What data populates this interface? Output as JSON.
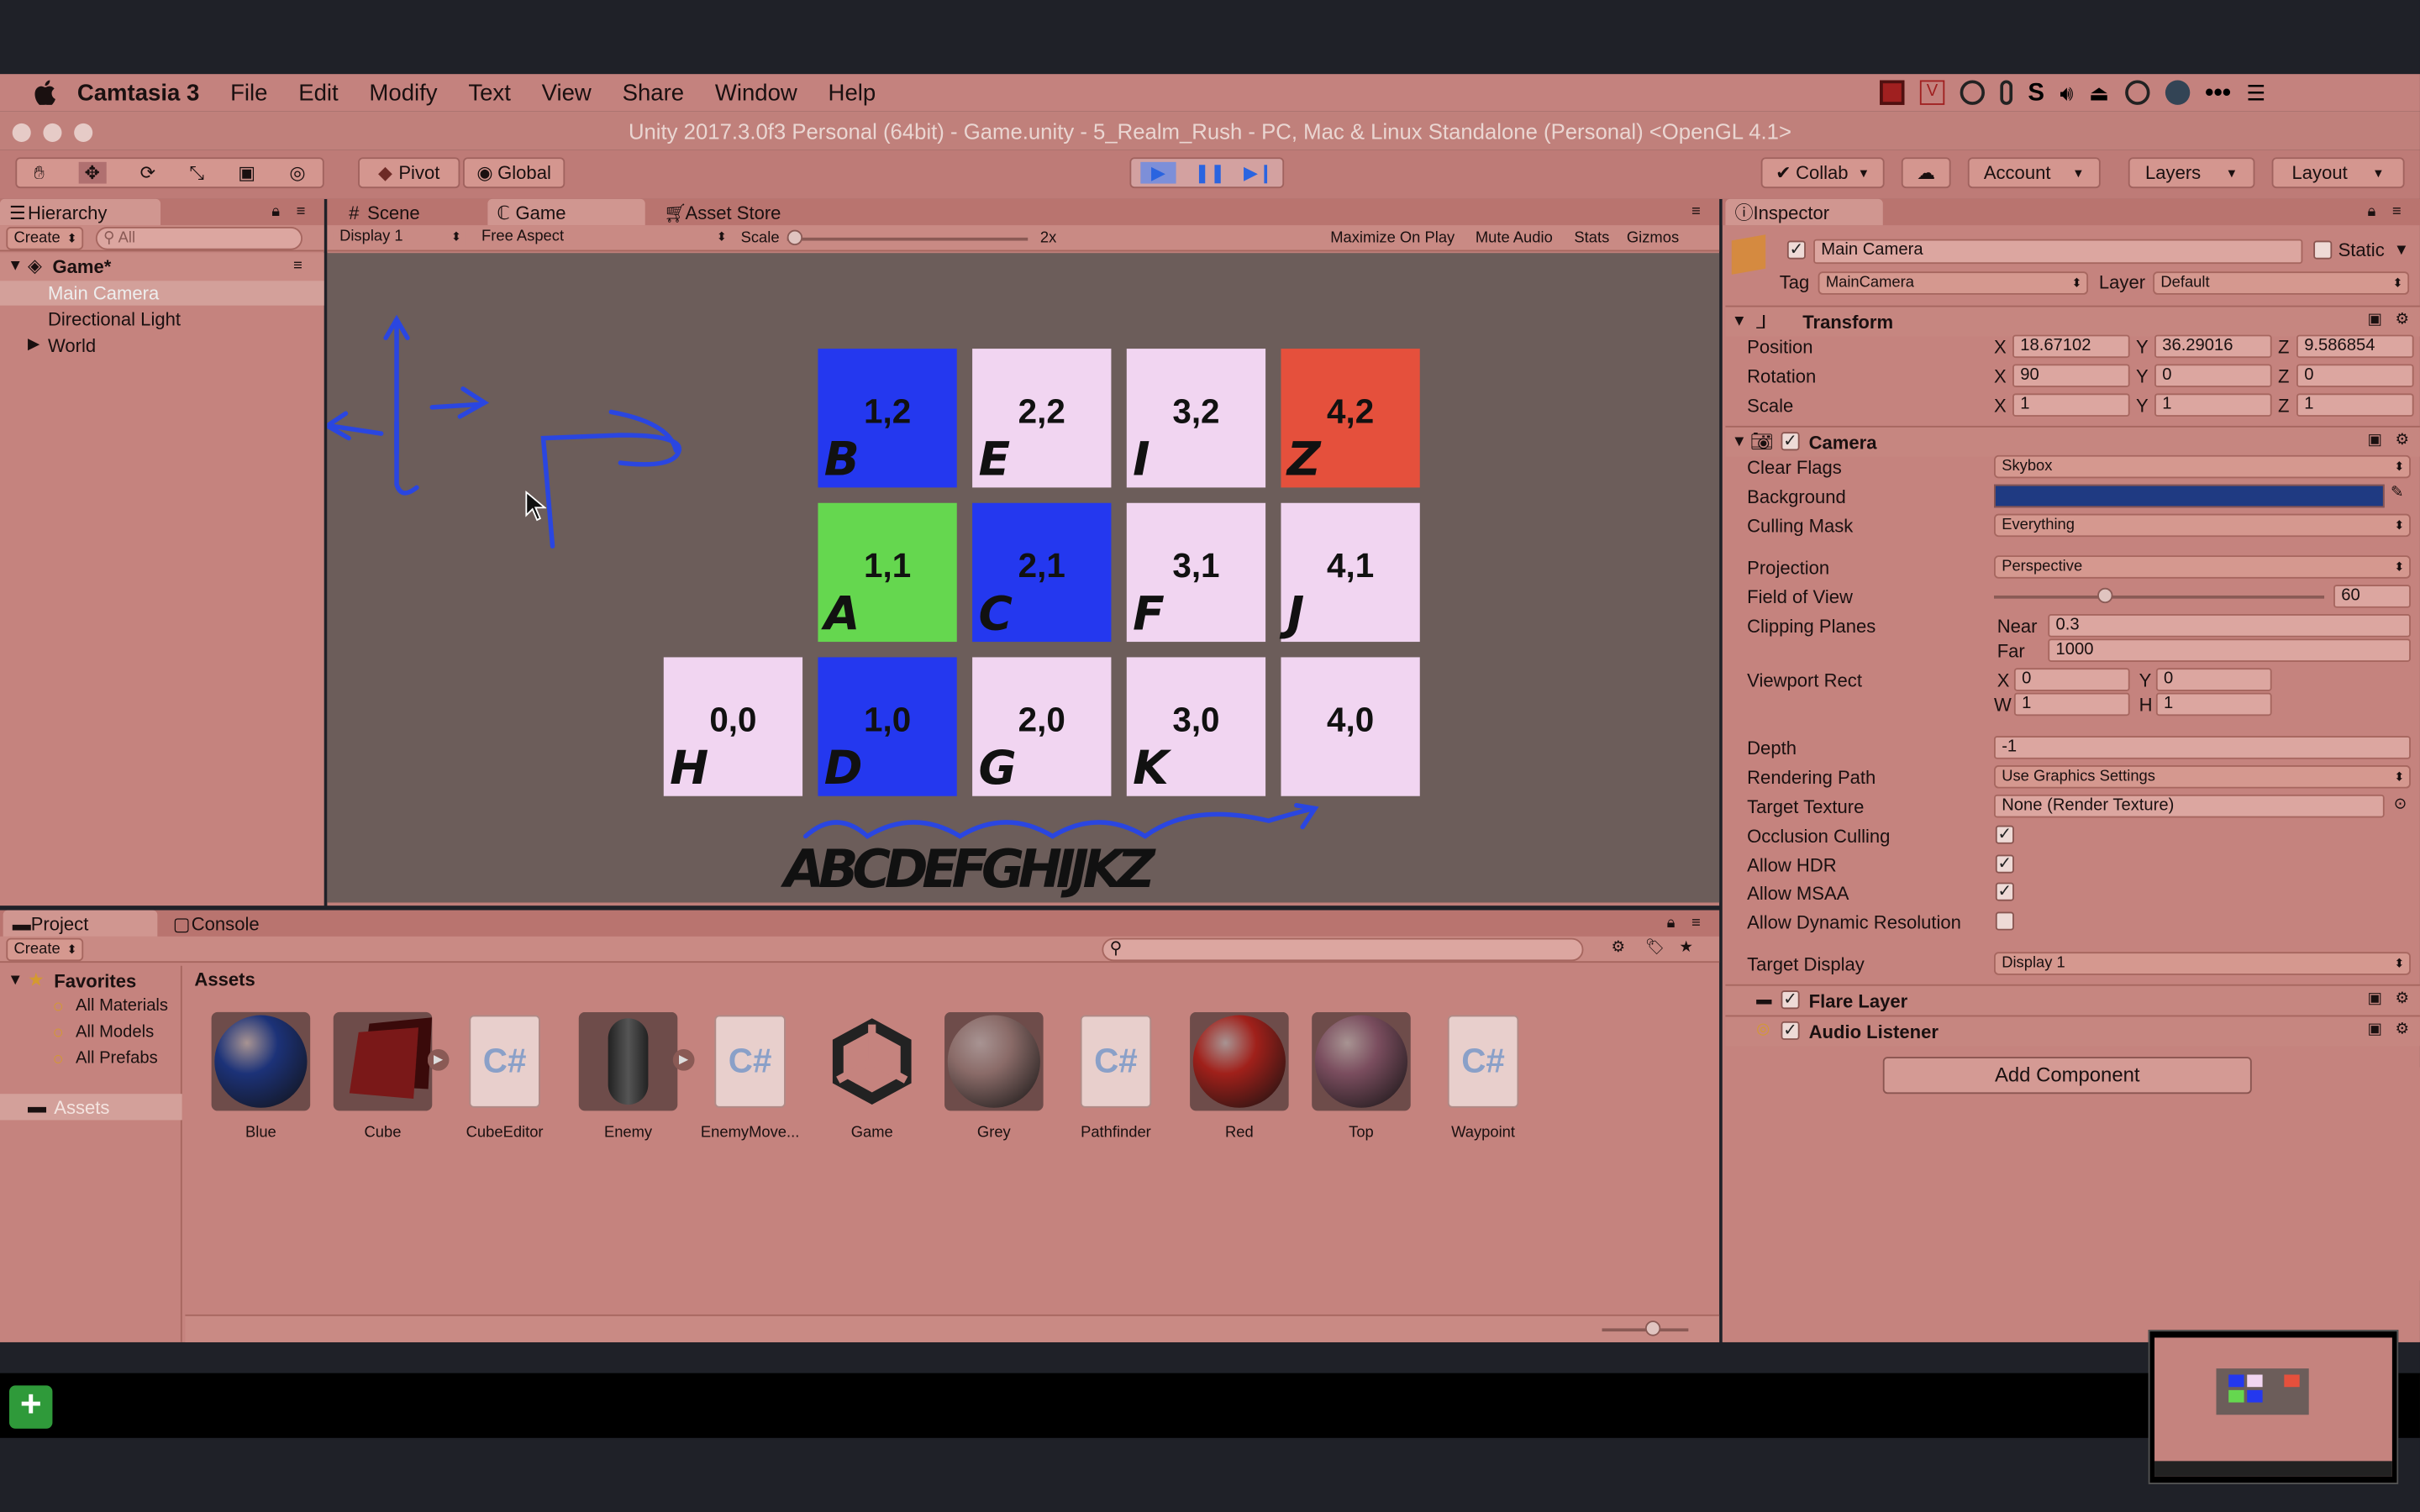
{
  "menubar": {
    "app": "Camtasia 3",
    "items": [
      "File",
      "Edit",
      "Modify",
      "Text",
      "View",
      "Share",
      "Window",
      "Help"
    ]
  },
  "window": {
    "title": "Unity 2017.3.0f3 Personal (64bit) - Game.unity - 5_Realm_Rush - PC, Mac & Linux Standalone (Personal) <OpenGL 4.1>"
  },
  "toolbar": {
    "pivot": "Pivot",
    "global": "Global",
    "collab": "Collab",
    "account": "Account",
    "layers": "Layers",
    "layout": "Layout"
  },
  "hierarchy": {
    "tab": "Hierarchy",
    "create": "Create",
    "search_placeholder": "All",
    "scene": "Game*",
    "items": [
      "Main Camera",
      "Directional Light",
      "World"
    ]
  },
  "center_tabs": {
    "scene": "Scene",
    "game": "Game",
    "asset_store": "Asset Store"
  },
  "game_bar": {
    "display": "Display 1",
    "aspect": "Free Aspect",
    "scale_label": "Scale",
    "scale_value": "2x",
    "maximize": "Maximize On Play",
    "mute": "Mute Audio",
    "stats": "Stats",
    "gizmos": "Gizmos"
  },
  "grid": {
    "tiles": [
      {
        "coord": "1,2",
        "letter": "B",
        "color": "#2438ef"
      },
      {
        "coord": "2,2",
        "letter": "E",
        "color": "#f1d5f1"
      },
      {
        "coord": "3,2",
        "letter": "I",
        "color": "#f1d5f1"
      },
      {
        "coord": "4,2",
        "letter": "Z",
        "color": "#e5503c"
      },
      {
        "coord": "1,1",
        "letter": "A",
        "color": "#65d74f"
      },
      {
        "coord": "2,1",
        "letter": "C",
        "color": "#2438ef"
      },
      {
        "coord": "3,1",
        "letter": "F",
        "color": "#f1d5f1"
      },
      {
        "coord": "4,1",
        "letter": "J",
        "color": "#f1d5f1"
      },
      {
        "coord": "0,0",
        "letter": "H",
        "color": "#f1d5f1"
      },
      {
        "coord": "1,0",
        "letter": "D",
        "color": "#2438ef"
      },
      {
        "coord": "2,0",
        "letter": "G",
        "color": "#f1d5f1"
      },
      {
        "coord": "3,0",
        "letter": "K",
        "color": "#f1d5f1"
      },
      {
        "coord": "4,0",
        "letter": "",
        "color": "#f1d5f1"
      }
    ],
    "scribble": "ABCDEFGHIJKZ"
  },
  "project": {
    "tab": "Project",
    "console": "Console",
    "create": "Create",
    "favorites": "Favorites",
    "fav_items": [
      "All Materials",
      "All Models",
      "All Prefabs"
    ],
    "assets_folder": "Assets",
    "breadcrumb": "Assets",
    "assets": [
      {
        "name": "Blue",
        "kind": "sphere",
        "color": "#1c3278"
      },
      {
        "name": "Cube",
        "kind": "cube",
        "color": "#7a1818"
      },
      {
        "name": "CubeEditor",
        "kind": "script",
        "color": ""
      },
      {
        "name": "Enemy",
        "kind": "capsule",
        "color": "#444"
      },
      {
        "name": "EnemyMove...",
        "kind": "script",
        "color": ""
      },
      {
        "name": "Game",
        "kind": "unity",
        "color": ""
      },
      {
        "name": "Grey",
        "kind": "sphere",
        "color": "#8a6b68"
      },
      {
        "name": "Pathfinder",
        "kind": "script",
        "color": ""
      },
      {
        "name": "Red",
        "kind": "sphere",
        "color": "#a0201a"
      },
      {
        "name": "Top",
        "kind": "sphere",
        "color": "#7a4d5e"
      },
      {
        "name": "Waypoint",
        "kind": "script",
        "color": ""
      }
    ]
  },
  "inspector": {
    "tab": "Inspector",
    "object_name": "Main Camera",
    "static": "Static",
    "tag_label": "Tag",
    "tag": "MainCamera",
    "layer_label": "Layer",
    "layer": "Default",
    "transform": {
      "title": "Transform",
      "position": "Position",
      "rotation": "Rotation",
      "scale": "Scale",
      "pos": [
        "18.67102",
        "36.29016",
        "9.586854"
      ],
      "rot": [
        "90",
        "0",
        "0"
      ],
      "scl": [
        "1",
        "1",
        "1"
      ]
    },
    "camera": {
      "title": "Camera",
      "clear_flags": "Clear Flags",
      "clear_flags_val": "Skybox",
      "background": "Background",
      "culling_mask": "Culling Mask",
      "culling_val": "Everything",
      "projection": "Projection",
      "projection_val": "Perspective",
      "fov": "Field of View",
      "fov_val": "60",
      "clipping": "Clipping Planes",
      "near": "Near",
      "near_val": "0.3",
      "far": "Far",
      "far_val": "1000",
      "viewport": "Viewport Rect",
      "vx": "0",
      "vy": "0",
      "vw": "1",
      "vh": "1",
      "depth": "Depth",
      "depth_val": "-1",
      "rendering_path": "Rendering Path",
      "rendering_val": "Use Graphics Settings",
      "target_texture": "Target Texture",
      "target_texture_val": "None (Render Texture)",
      "occlusion": "Occlusion Culling",
      "hdr": "Allow HDR",
      "msaa": "Allow MSAA",
      "dynres": "Allow Dynamic Resolution",
      "target_display": "Target Display",
      "target_display_val": "Display 1"
    },
    "flare": "Flare Layer",
    "audio": "Audio Listener",
    "add_component": "Add Component"
  },
  "colors": {
    "background_swatch": "#1f3a82",
    "accent_play": "#3a78e8"
  }
}
